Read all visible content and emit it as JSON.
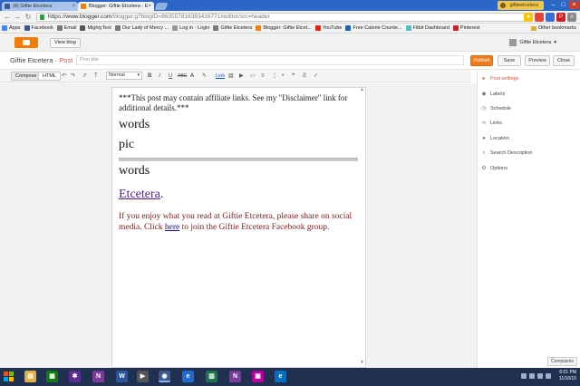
{
  "browser": {
    "tabs": [
      {
        "label": "(8) Giftie Etcetera",
        "favicon_color": "#3b5998"
      },
      {
        "label": "Blogger: Giftie Etcetera - E",
        "favicon_color": "#f57d00"
      }
    ],
    "profile_name": "giftieetcetera",
    "url_host": "https://www.blogger.com",
    "url_rest": "/blogger.g?blogID=8635578163834167​71#editor/src=header",
    "bookmarks": [
      {
        "label": "Apps",
        "color": "#4285f4"
      },
      {
        "label": "Facebook",
        "color": "#3b5998"
      },
      {
        "label": "Email",
        "color": "#777777"
      },
      {
        "label": "MightyText",
        "color": "#555555"
      },
      {
        "label": "Our Lady of Mercy ...",
        "color": "#777777"
      },
      {
        "label": "Log in · Login",
        "color": "#999999"
      },
      {
        "label": "Giftie Etcetera",
        "color": "#777777"
      },
      {
        "label": "Blogger: Giftie Etcet...",
        "color": "#f57d00"
      },
      {
        "label": "YouTube",
        "color": "#e62117"
      },
      {
        "label": "Free Calorie Counte...",
        "color": "#1565c0"
      },
      {
        "label": "Fitbit Dashboard",
        "color": "#4cc2c4"
      },
      {
        "label": "Pinterest",
        "color": "#cb2027"
      }
    ],
    "other_bookmarks": "Other bookmarks"
  },
  "blogger": {
    "view_blog": "View blog",
    "user_name": "Giftie Etcetera",
    "blog_name": "Giftie Etcetera",
    "separator": " · ",
    "post_word": "Post",
    "title_placeholder": "Post title",
    "buttons": {
      "publish": "Publish",
      "save": "Save",
      "preview": "Preview",
      "close": "Close"
    },
    "modes": {
      "compose": "Compose",
      "html": "HTML"
    },
    "font_select": "Normal",
    "link_label": "Link"
  },
  "post": {
    "disclaimer": "***This post may contain affiliate links. See my \"Disclaimer\" link for additional details.***",
    "words1": "words",
    "pic": "pic",
    "words2": "words",
    "link_text": "Etcetera",
    "link_suffix": ".",
    "share_before": "If you enjoy what you read at Giftie Etcetera, please share on social media. Click ",
    "share_link": "here",
    "share_after": " to join the Giftie Etcetera Facebook group."
  },
  "sidebar": {
    "title": "Post settings",
    "items": [
      "Labels",
      "Schedule",
      "Links",
      "Location",
      "Search Description",
      "Options"
    ],
    "bottom_button": "Complaints"
  },
  "taskbar": {
    "time": "6:01 PM",
    "date": "11/16/15"
  }
}
